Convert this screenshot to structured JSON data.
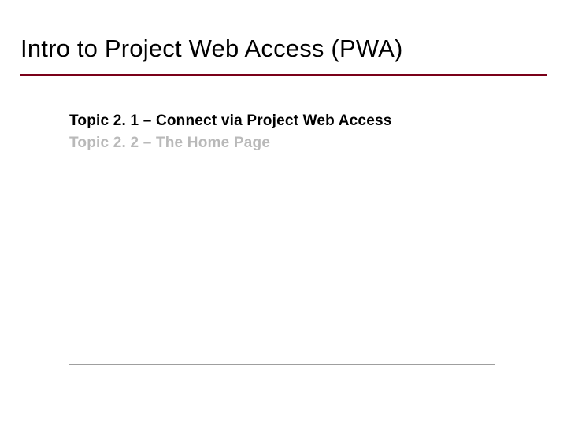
{
  "title": "Intro to Project Web Access (PWA)",
  "topics": [
    {
      "label": "Topic 2. 1 – Connect via Project Web Access",
      "state": "active"
    },
    {
      "label": "Topic 2. 2 – The Home Page",
      "state": "inactive"
    }
  ]
}
